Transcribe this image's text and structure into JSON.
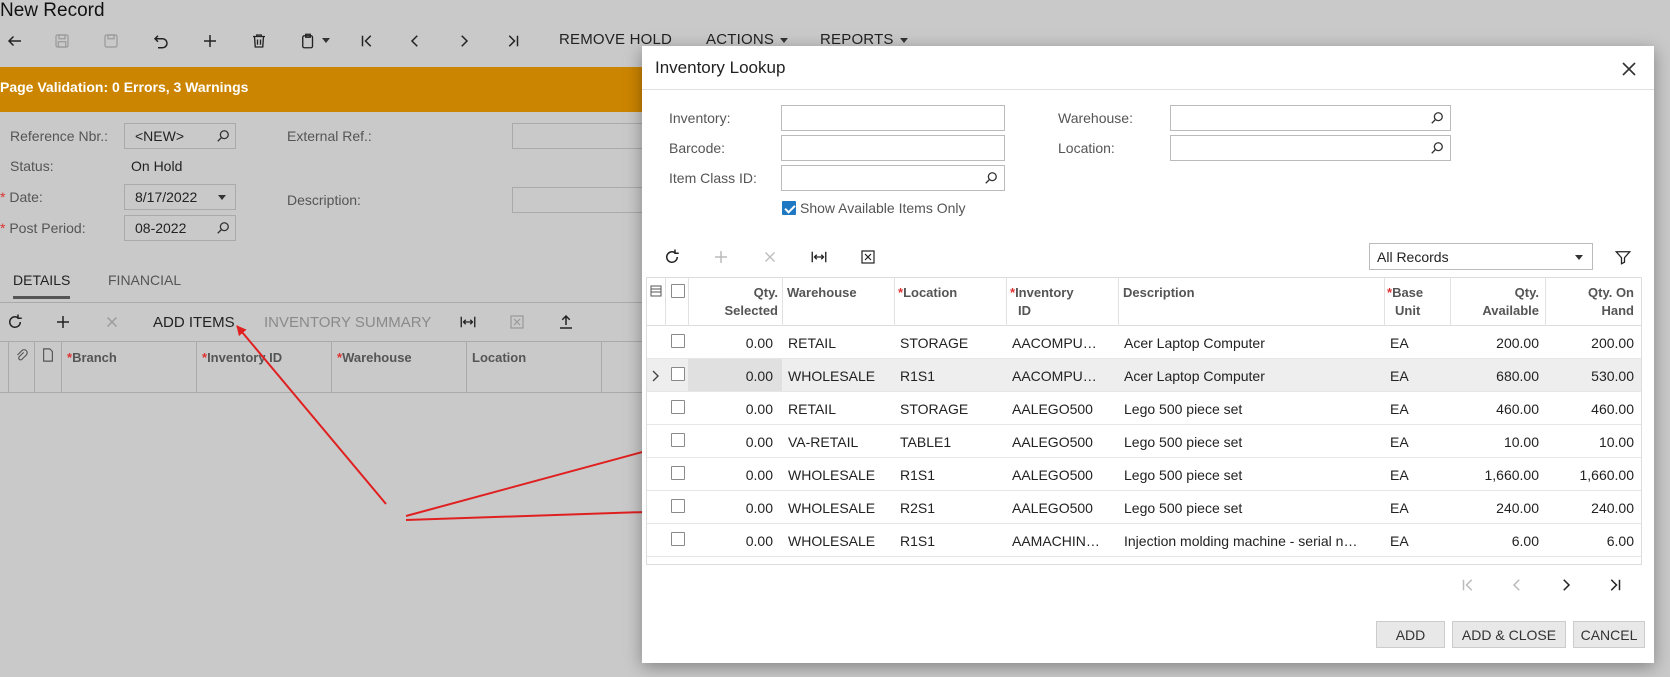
{
  "page": {
    "title": "New Record",
    "toolbar": {
      "remove_hold": "REMOVE HOLD",
      "actions": "ACTIONS",
      "reports": "REPORTS"
    },
    "validation_message": "Page Validation: 0 Errors, 3 Warnings",
    "form": {
      "reference_nbr_label": "Reference Nbr.:",
      "reference_nbr_value": "<NEW>",
      "status_label": "Status:",
      "status_value": "On Hold",
      "date_label": "Date:",
      "date_value": "8/17/2022",
      "post_period_label": "Post Period:",
      "post_period_value": "08-2022",
      "external_ref_label": "External Ref.:",
      "description_label": "Description:"
    },
    "tabs": [
      "DETAILS",
      "FINANCIAL"
    ],
    "details_toolbar": {
      "add_items": "ADD ITEMS",
      "inventory_summary": "INVENTORY SUMMARY"
    },
    "details_columns": {
      "branch": "Branch",
      "inventory_id": "Inventory ID",
      "warehouse": "Warehouse",
      "location": "Location"
    }
  },
  "dialog": {
    "title": "Inventory Lookup",
    "filters": {
      "inventory_label": "Inventory:",
      "barcode_label": "Barcode:",
      "item_class_label": "Item Class ID:",
      "warehouse_label": "Warehouse:",
      "location_label": "Location:",
      "show_available_label": "Show Available Items Only",
      "show_available_checked": true
    },
    "records_filter": "All Records",
    "columns": {
      "qty_selected": [
        "Qty.",
        "Selected"
      ],
      "warehouse": "Warehouse",
      "location": "Location",
      "inventory_id": [
        "Inventory",
        "ID"
      ],
      "description": "Description",
      "base_unit": [
        "Base",
        "Unit"
      ],
      "qty_available": [
        "Qty.",
        "Available"
      ],
      "qty_on_hand": [
        "Qty. On",
        "Hand"
      ]
    },
    "rows": [
      {
        "qty_selected": "0.00",
        "warehouse": "RETAIL",
        "location": "STORAGE",
        "inventory_id": "AACOMPU…",
        "description": "Acer Laptop Computer",
        "base_unit": "EA",
        "qty_available": "200.00",
        "qty_on_hand": "200.00"
      },
      {
        "qty_selected": "0.00",
        "warehouse": "WHOLESALE",
        "location": "R1S1",
        "inventory_id": "AACOMPU…",
        "description": "Acer Laptop Computer",
        "base_unit": "EA",
        "qty_available": "680.00",
        "qty_on_hand": "530.00"
      },
      {
        "qty_selected": "0.00",
        "warehouse": "RETAIL",
        "location": "STORAGE",
        "inventory_id": "AALEGO500",
        "description": "Lego 500 piece set",
        "base_unit": "EA",
        "qty_available": "460.00",
        "qty_on_hand": "460.00"
      },
      {
        "qty_selected": "0.00",
        "warehouse": "VA-RETAIL",
        "location": "TABLE1",
        "inventory_id": "AALEGO500",
        "description": "Lego 500 piece set",
        "base_unit": "EA",
        "qty_available": "10.00",
        "qty_on_hand": "10.00"
      },
      {
        "qty_selected": "0.00",
        "warehouse": "WHOLESALE",
        "location": "R1S1",
        "inventory_id": "AALEGO500",
        "description": "Lego 500 piece set",
        "base_unit": "EA",
        "qty_available": "1,660.00",
        "qty_on_hand": "1,660.00"
      },
      {
        "qty_selected": "0.00",
        "warehouse": "WHOLESALE",
        "location": "R2S1",
        "inventory_id": "AALEGO500",
        "description": "Lego 500 piece set",
        "base_unit": "EA",
        "qty_available": "240.00",
        "qty_on_hand": "240.00"
      },
      {
        "qty_selected": "0.00",
        "warehouse": "WHOLESALE",
        "location": "R1S1",
        "inventory_id": "AAMACHIN…",
        "description": "Injection molding machine - serial n…",
        "base_unit": "EA",
        "qty_available": "6.00",
        "qty_on_hand": "6.00"
      }
    ],
    "selected_row_index": 1,
    "buttons": {
      "add": "ADD",
      "add_close": "ADD & CLOSE",
      "cancel": "CANCEL"
    }
  },
  "colors": {
    "validation_bar": "#cc8500",
    "annotation_arrow": "#e02020",
    "checkbox_accent": "#1e78c2",
    "required_marker": "#dd3333"
  }
}
